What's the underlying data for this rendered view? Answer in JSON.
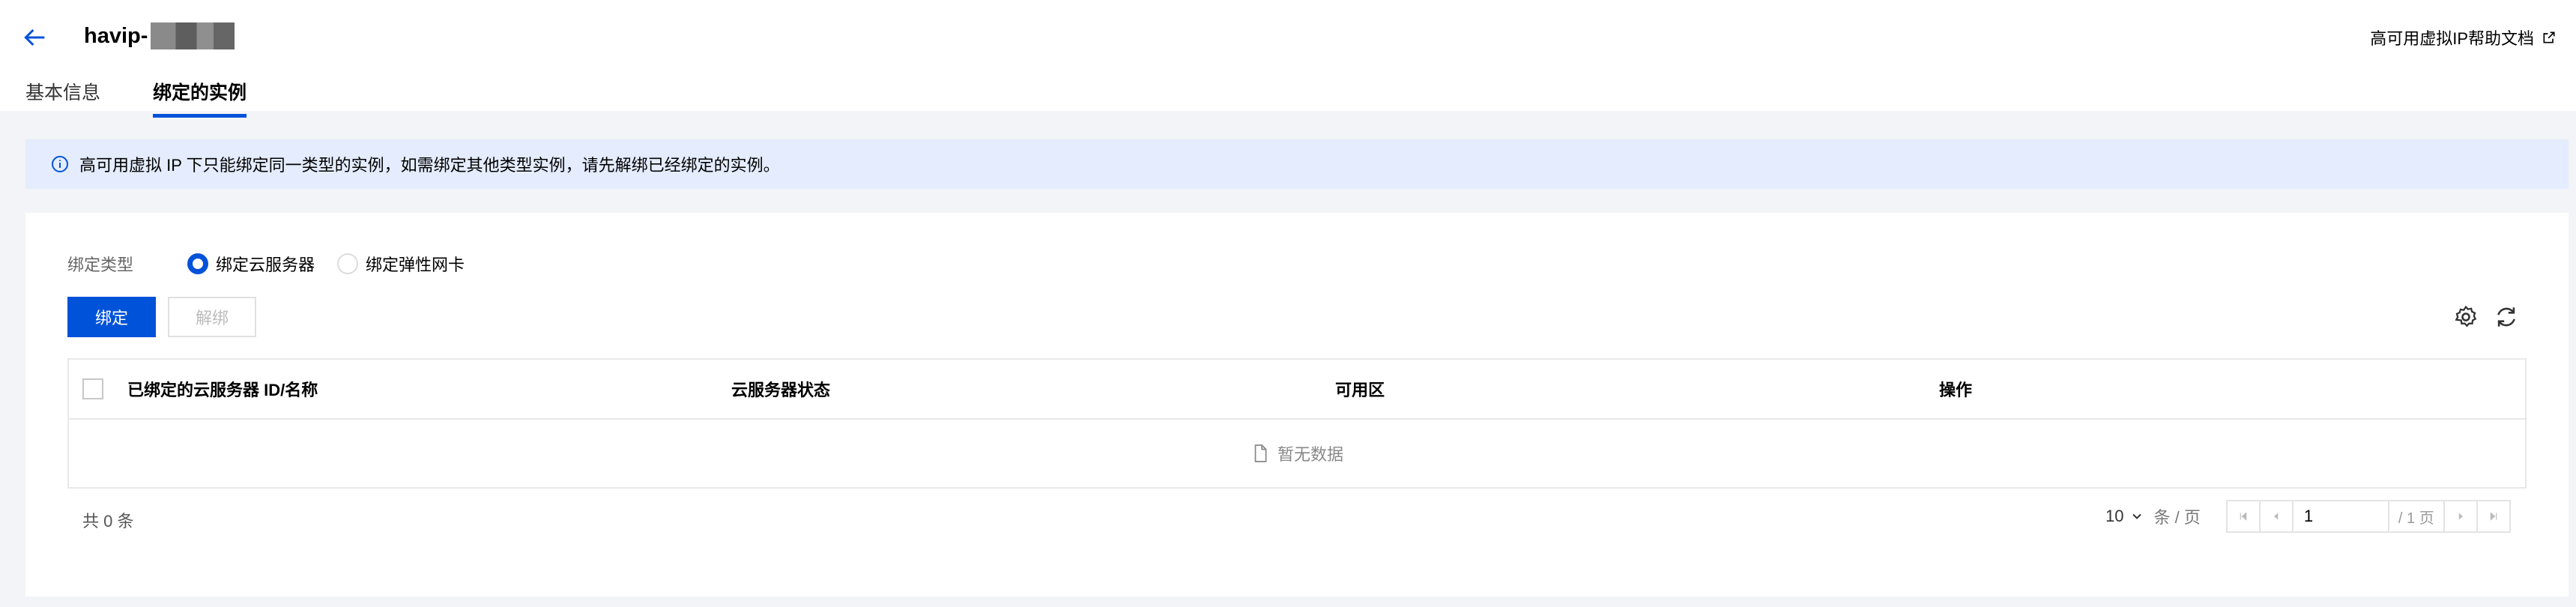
{
  "header": {
    "title": "havip-",
    "help_link": "高可用虚拟IP帮助文档"
  },
  "tabs": [
    {
      "label": "基本信息",
      "active": false
    },
    {
      "label": "绑定的实例",
      "active": true
    }
  ],
  "notice": {
    "text": "高可用虚拟 IP 下只能绑定同一类型的实例，如需绑定其他类型实例，请先解绑已经绑定的实例。"
  },
  "bind_type": {
    "label": "绑定类型",
    "options": [
      {
        "label": "绑定云服务器",
        "selected": true
      },
      {
        "label": "绑定弹性网卡",
        "selected": false
      }
    ]
  },
  "toolbar": {
    "bind_label": "绑定",
    "unbind_label": "解绑"
  },
  "table": {
    "columns": [
      "已绑定的云服务器 ID/名称",
      "云服务器状态",
      "可用区",
      "操作"
    ],
    "empty_text": "暂无数据"
  },
  "footer": {
    "total_text": "共 0 条",
    "page_size": "10",
    "page_size_unit": "条 / 页",
    "current_page": "1",
    "total_pages": "/ 1 页"
  },
  "colors": {
    "primary": "#0052d9",
    "notice_bg": "#e4ecfd",
    "page_bg": "#f3f4f7"
  }
}
